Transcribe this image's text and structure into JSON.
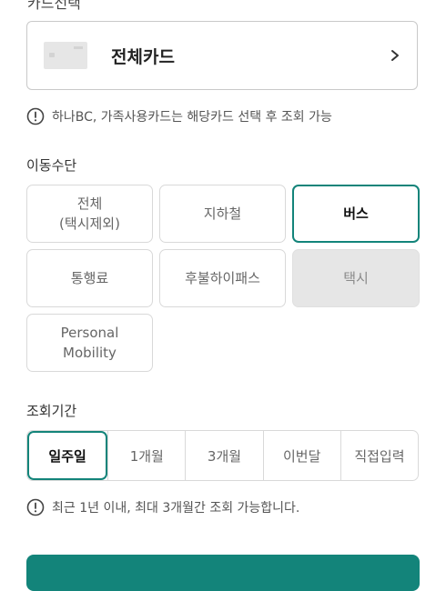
{
  "card_section": {
    "title": "카드선택",
    "selected_card": "전체카드",
    "notice": "하나BC, 가족사용카드는 해당카드 선택 후 조회 가능"
  },
  "transport": {
    "title": "이동수단",
    "options": [
      {
        "label": "전체\n(택시제외)",
        "state": "normal"
      },
      {
        "label": "지하철",
        "state": "normal"
      },
      {
        "label": "버스",
        "state": "selected"
      },
      {
        "label": "통행료",
        "state": "normal"
      },
      {
        "label": "후불하이패스",
        "state": "normal"
      },
      {
        "label": "택시",
        "state": "disabled"
      },
      {
        "label": "Personal\nMobility",
        "state": "normal"
      }
    ]
  },
  "period": {
    "title": "조회기간",
    "options": [
      {
        "label": "일주일",
        "selected": true
      },
      {
        "label": "1개월",
        "selected": false
      },
      {
        "label": "3개월",
        "selected": false
      },
      {
        "label": "이번달",
        "selected": false
      },
      {
        "label": "직접입력",
        "selected": false
      }
    ],
    "notice": "최근 1년 이내, 최대 3개월간 조회 가능합니다."
  },
  "colors": {
    "accent": "#13847a",
    "disabled_bg": "#e6e6e6",
    "border": "#d9d9d9"
  },
  "icons": {
    "notice": "exclamation-circle-icon",
    "chevron": "chevron-right-icon"
  }
}
